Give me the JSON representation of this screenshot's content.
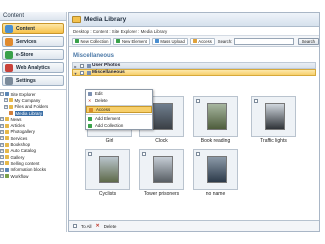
{
  "sidebar": {
    "title": "Content",
    "buttons": [
      "Content",
      "Services",
      "e-Store",
      "Web Analytics",
      "Settings"
    ],
    "tree": [
      "Site Explorer",
      "My Company",
      "Files and Folders",
      "Media Library",
      "News",
      "Articles",
      "Photogallery",
      "Services",
      "Bookshop",
      "Auto Catalog",
      "Gallery",
      "Selling content",
      "Information blocks",
      "Workflow"
    ]
  },
  "main": {
    "title": "Media Library",
    "breadcrumb": "Desktop : Content : Site Explorer : Media Library",
    "toolbar": {
      "new_collection": "New Collection",
      "new_element": "New Element",
      "mass_upload": "Mass Upload",
      "access": "Access",
      "search_label": "Search:",
      "search_value": "",
      "search_button": "Search"
    },
    "section_title": "Miscellaneous",
    "groups": [
      "User Photos",
      "Miscellaneous"
    ],
    "items": [
      "Girl",
      "Clock",
      "Book reading",
      "Traffic lights",
      "Cyclists",
      "Tower prisoners",
      "no name"
    ],
    "context_menu": [
      "Edit",
      "Delete",
      "Access",
      "Add Element",
      "Add Collection"
    ],
    "footer": {
      "to_all": "To All",
      "delete": "Delete"
    }
  },
  "colors": {
    "accent": "#f7cf6b",
    "section_title": "#4d7aa8",
    "sidebar_active": "#f6c24a"
  }
}
